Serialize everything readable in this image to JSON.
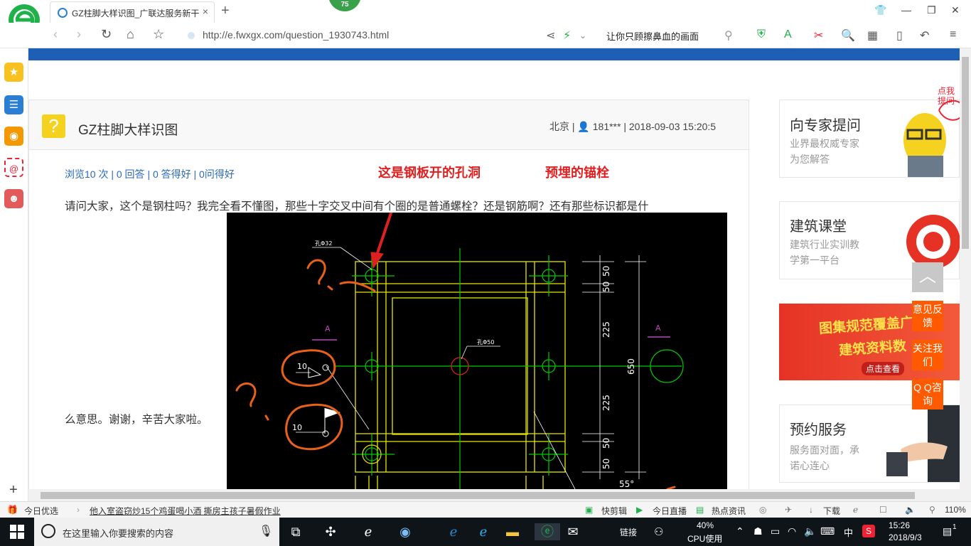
{
  "browser": {
    "tab_title": "GZ柱脚大样识图_广联达服务新干线",
    "tab_close": "×",
    "new_tab": "+",
    "badge": "75",
    "url": "http://e.fwxgx.com/question_1930743.html",
    "search_text": "让你只顾擦鼻血的画面"
  },
  "question": {
    "title": "GZ柱脚大样识图",
    "location": "北京",
    "user": "181***",
    "datetime": "2018-09-03 15:20:5",
    "stats": "浏览10 次 | 0 回答 | 0 答得好 | 0问得好",
    "body_line1": "请问大家，这个是钢柱吗？我完全看不懂图，那些十字交叉中间有个圈的是普通螺栓？还是钢筋啊？还有那些标识都是什",
    "body_line2": "么意思。谢谢，辛苦大家啦。",
    "annotation_left": "这是钢板开的孔洞",
    "annotation_right": "预埋的锚栓"
  },
  "cad": {
    "label_hole_top": "孔Φ32",
    "label_hole_center": "孔Φ50",
    "section_left": "A",
    "section_right": "A",
    "weld1": "10",
    "weld2": "10",
    "dim_50a": "50",
    "dim_50b": "50",
    "dim_225a": "225",
    "dim_225b": "225",
    "dim_50c": "50",
    "dim_50d": "50",
    "dim_total": "650",
    "dim_angle": "55°"
  },
  "sidebar_right": {
    "card1_title": "向专家提问",
    "card1_sub1": "业界最权威专家",
    "card1_sub2": "为您解答",
    "card1_bubble": "点我\n提问",
    "card2_title": "建筑课堂",
    "card2_sub1": "建筑行业实训教",
    "card2_sub2": "学第一平台",
    "card3_line1": "图集规范覆盖广",
    "card3_line2": "建筑资料数",
    "card3_link": "点击查看",
    "card4_title": "预约服务",
    "card4_sub1": "服务面对面，承",
    "card4_sub2": "诺心连心",
    "float_feedback": "意见反馈",
    "float_follow": "关注我们",
    "float_qq": "Q Q咨询"
  },
  "statusbar": {
    "today": "今日优选",
    "news": "他入室盗窃炒15个鸡蛋喝小酒 撕房主孩子暑假作业",
    "kuaijianji": "快剪辑",
    "live": "今日直播",
    "hot": "热点资讯",
    "download": "下载",
    "zoom": "110%"
  },
  "taskbar": {
    "search_placeholder": "在这里输入你要搜索的内容",
    "link": "链接",
    "cpu_percent": "40%",
    "cpu_label": "CPU使用",
    "ime": "中",
    "time": "15:26",
    "date": "2018/9/3",
    "notif": "1"
  },
  "colors": {
    "accent_blue": "#1d5fb4",
    "question_icon": "#f5d21f",
    "float_orange": "#ff5a00",
    "annotation_red": "#e02020",
    "cad_yellow": "#e6e600",
    "cad_green": "#00cc00"
  }
}
